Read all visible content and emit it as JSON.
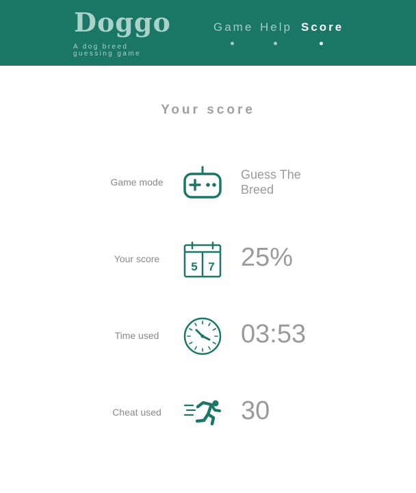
{
  "app": {
    "title": "Doggo",
    "subtitle": "A dog breed guessing game"
  },
  "nav": {
    "items": [
      {
        "label": "Game"
      },
      {
        "label": "Help"
      },
      {
        "label": "Score"
      }
    ],
    "active": "Score"
  },
  "page": {
    "title": "Your score"
  },
  "stats": {
    "game_mode": {
      "label": "Game mode",
      "value": "Guess The Breed",
      "icon": "gamepad-icon"
    },
    "score": {
      "label": "Your score",
      "value": "25%",
      "icon": "calendar-icon",
      "icon_digits": [
        "5",
        "7"
      ]
    },
    "time": {
      "label": "Time used",
      "value": "03:53",
      "icon": "clock-icon"
    },
    "cheat": {
      "label": "Cheat used",
      "value": "30",
      "icon": "running-man-icon"
    }
  },
  "colors": {
    "header_bg": "#1a7766",
    "accent": "#1a7766",
    "logo": "#a9d3c9",
    "text_muted": "#9a9a9a"
  }
}
